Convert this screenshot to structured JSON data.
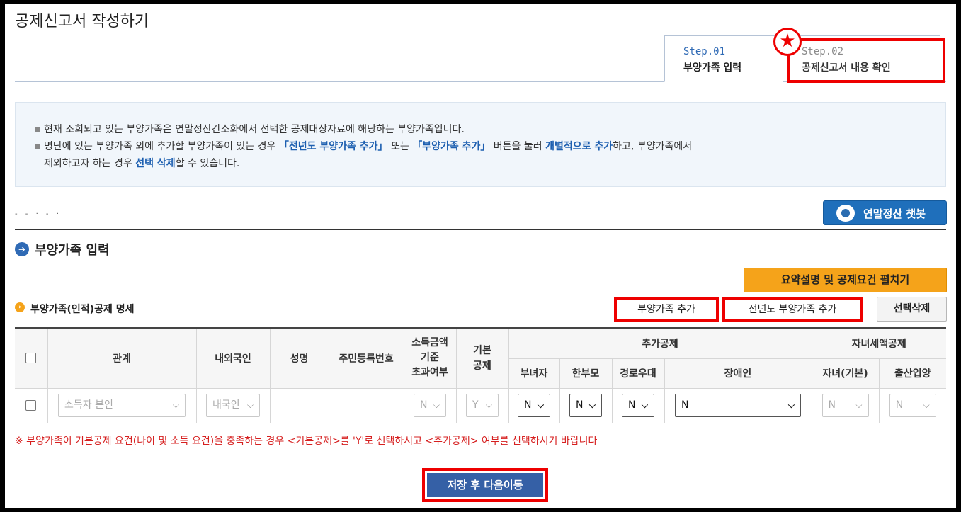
{
  "page": {
    "title": "공제신고서 작성하기"
  },
  "tabs": [
    {
      "step": "Step.01",
      "label": "부양가족 입력"
    },
    {
      "step": "Step.02",
      "label": "공제신고서 내용 확인"
    }
  ],
  "star_icon": "★",
  "notice": {
    "line1": "현재 조회되고 있는 부양가족은 연말정산간소화에서 선택한 공제대상자료에 해당하는 부양가족입니다.",
    "line2_a": "명단에 있는 부양가족 외에 추가할 부양가족이 있는 경우 ",
    "line2_b": "「전년도 부양가족 추가」",
    "line2_c": " 또는 ",
    "line2_d": "「부양가족 추가」",
    "line2_e": " 버튼을 눌러 ",
    "line2_f": "개별적으로 추가",
    "line2_g": "하고, 부양가족에서",
    "line3_a": "제외하고자 하는 경우 ",
    "line3_b": "선택 삭제",
    "line3_c": "할 수 있습니다."
  },
  "chatbot": {
    "label": "연말정산 챗봇"
  },
  "small_text": "- - · -  ·",
  "section": {
    "title": "부양가족 입력"
  },
  "expand_button": "요약설명 및 공제요건 펼치기",
  "subsection": {
    "title": "부양가족(인적)공제 명세"
  },
  "buttons": {
    "add_dependent": "부양가족 추가",
    "add_prev_year": "전년도 부양가족 추가",
    "delete_selected": "선택삭제"
  },
  "table": {
    "headers": {
      "relation": "관계",
      "nationality": "내외국인",
      "name": "성명",
      "rrn": "주민등록번호",
      "income_over_l1": "소득금액",
      "income_over_l2": "기준",
      "income_over_l3": "초과여부",
      "basic_l1": "기본",
      "basic_l2": "공제",
      "additional": "추가공제",
      "child_tax": "자녀세액공제",
      "woman_head": "부녀자",
      "single_parent": "한부모",
      "senior": "경로우대",
      "disabled": "장애인",
      "child_basic": "자녀(기본)",
      "birth_adopt": "출산입양"
    },
    "row": {
      "relation": "소득자 본인",
      "nationality": "내국인",
      "name": "",
      "rrn": "",
      "income_over": "N",
      "basic": "Y",
      "woman_head": "N",
      "single_parent": "N",
      "senior": "N",
      "disabled": "N",
      "child_basic": "N",
      "birth_adopt": "N"
    }
  },
  "warning": "※ 부양가족이 기본공제 요건(나이 및 소득 요건)을 충족하는 경우 <기본공제>를 'Y'로 선택하시고 <추가공제> 여부를 선택하시기 바랍니다",
  "save_button": "저장 후 다음이동"
}
